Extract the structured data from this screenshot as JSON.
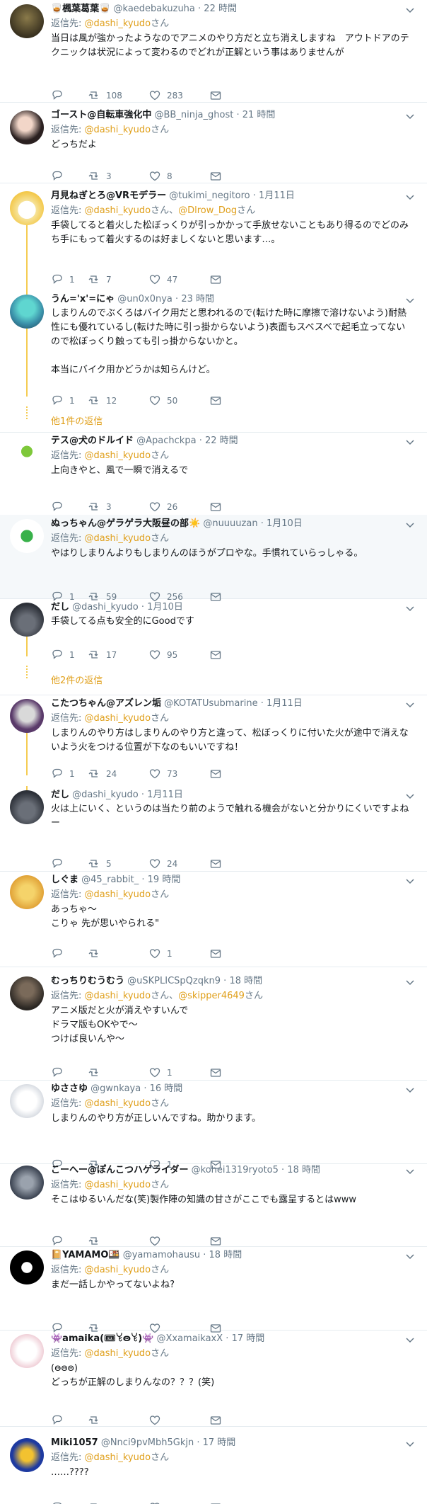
{
  "reply_prefix": "返信先: ",
  "san": "さん",
  "joiner": "、",
  "more_replies": [
    "他1件の返信",
    "他2件の返信"
  ],
  "colors": {
    "accent": "#e0a01c",
    "thread": "#f5cc52",
    "muted": "#657786"
  },
  "tweets": [
    {
      "name": "🥃楓葉葛葉🥃",
      "handle": "@kaedebakuzuha",
      "time": "22 時間",
      "reply_to": [
        "@dashi_kyudo"
      ],
      "text": "当日は風が強かったようなのでアニメのやり方だと立ち消えしますね　アウトドアのテクニックは状況によって変わるのでどれが正解という事はありませんが",
      "replies": "",
      "retweets": "108",
      "likes": "283"
    },
    {
      "name": "ゴースト@自転車強化中",
      "handle": "@BB_ninja_ghost",
      "time": "21 時間",
      "reply_to": [
        "@dashi_kyudo"
      ],
      "text": "どっちだよ",
      "replies": "",
      "retweets": "3",
      "likes": "8"
    },
    {
      "name": "月見ねぎとろ@VRモデラー",
      "handle": "@tukimi_negitoro",
      "time": "1月11日",
      "reply_to": [
        "@dashi_kyudo",
        "@Dlrow_Dog"
      ],
      "text": "手袋してると着火した松ぼっくりが引っかかって手放せないこともあり得るのでどのみち手にもって着火するのは好ましくないと思います…。",
      "replies": "1",
      "retweets": "7",
      "likes": "47"
    },
    {
      "name": "うん='x'=にゃ",
      "handle": "@un0x0nya",
      "time": "23 時間",
      "reply_to": [],
      "text": "しまりんのでぶくろはバイク用だと思われるので(転けた時に摩擦で溶けないよう)耐熱性にも優れているし(転けた時に引っ掛からないよう)表面もスベスベで起毛立ってないので松ぼっくり触っても引っ掛からないかと。\n\n本当にバイク用かどうかは知らんけど。",
      "replies": "1",
      "retweets": "12",
      "likes": "50"
    },
    {
      "name": "テス@犬のドルイド",
      "handle": "@Apachckpa",
      "time": "22 時間",
      "reply_to": [
        "@dashi_kyudo"
      ],
      "text": "上向きやと、風で一瞬で消えるで",
      "replies": "",
      "retweets": "3",
      "likes": "26"
    },
    {
      "name": "ぬっちゃん@ゲラゲラ大阪昼の部☀️",
      "handle": "@nuuuuzan",
      "time": "1月10日",
      "reply_to": [
        "@dashi_kyudo"
      ],
      "text": "やはりしまりんよりもしまりんのほうがプロやな。手慣れていらっしゃる。",
      "replies": "1",
      "retweets": "59",
      "likes": "256"
    },
    {
      "name": "だし",
      "handle": "@dashi_kyudo",
      "time": "1月10日",
      "reply_to": [],
      "text": "手袋してる点も安全的にGoodです",
      "replies": "1",
      "retweets": "17",
      "likes": "95"
    },
    {
      "name": "こたつちゃん@アズレン垢",
      "handle": "@KOTATUsubmarine",
      "time": "1月11日",
      "reply_to": [
        "@dashi_kyudo"
      ],
      "text": "しまりんのやり方はしまりんのやり方と違って、松ぼっくりに付いた火が途中で消えないよう火をつける位置が下なのもいいですね！",
      "replies": "1",
      "retweets": "24",
      "likes": "73"
    },
    {
      "name": "だし",
      "handle": "@dashi_kyudo",
      "time": "1月11日",
      "reply_to": [],
      "text": "火は上にいく、というのは当たり前のようで触れる機会がないと分かりにくいですよねー",
      "replies": "",
      "retweets": "5",
      "likes": "24"
    },
    {
      "name": "しぐま",
      "handle": "@45_rabbit_",
      "time": "19 時間",
      "reply_to": [
        "@dashi_kyudo"
      ],
      "text": "あっちゃ～\nこりゃ 先が思いやられる\"",
      "replies": "",
      "retweets": "",
      "likes": "1"
    },
    {
      "name": "むっちりむうむう",
      "handle": "@uSKPLICSpQzqkn9",
      "time": "18 時間",
      "reply_to": [
        "@dashi_kyudo",
        "@skipper4649"
      ],
      "text": "アニメ版だと火が消えやすいんで\nドラマ版もOKやで～\nつけば良いんや～",
      "replies": "",
      "retweets": "",
      "likes": "1"
    },
    {
      "name": "ゆささゆ",
      "handle": "@gwnkaya",
      "time": "16 時間",
      "reply_to": [
        "@dashi_kyudo"
      ],
      "text": "しまりんのやり方が正しいんですね。助かります。",
      "replies": "",
      "retweets": "",
      "likes": "1"
    },
    {
      "name": "こーへー@ぽんこつハゲライダー",
      "handle": "@kohei1319ryoto5",
      "time": "18 時間",
      "reply_to": [
        "@dashi_kyudo"
      ],
      "text": "そこはゆるいんだな(笑)製作陣の知識の甘さがここでも露呈するとはwww",
      "replies": "",
      "retweets": "",
      "likes": ""
    },
    {
      "name": "📔YAMAMO🍱",
      "handle": "@yamamohausu",
      "time": "18 時間",
      "reply_to": [
        "@dashi_kyudo"
      ],
      "text": "まだ一話しかやってないよね?",
      "replies": "",
      "retweets": "",
      "likes": ""
    },
    {
      "name": "👾amaika(🎟ꒀꙫꒀ)👾",
      "handle": "@XxamaikaxX",
      "time": "17 時間",
      "reply_to": [
        "@dashi_kyudo"
      ],
      "text": "(ꙫꙫꙫ)\nどっちが正解のしまりんなの？？？(笑)",
      "replies": "",
      "retweets": "",
      "likes": ""
    },
    {
      "name": "Miki1057",
      "handle": "@Nnci9pvMbh5Gkjn",
      "time": "17 時間",
      "reply_to": [
        "@dashi_kyudo"
      ],
      "text": "……????",
      "replies": "",
      "retweets": "",
      "likes": ""
    }
  ]
}
